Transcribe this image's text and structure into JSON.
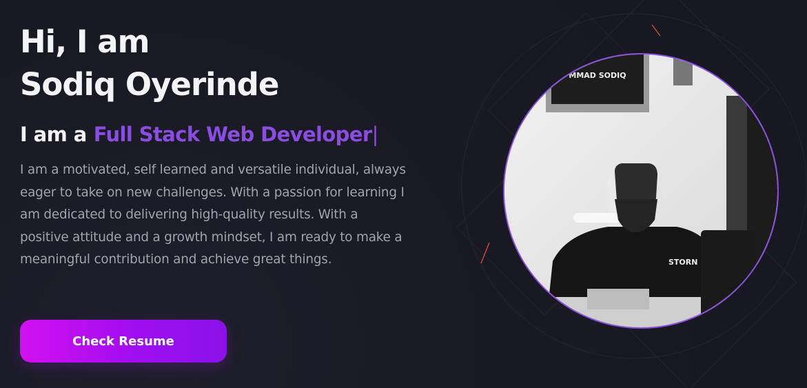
{
  "hero": {
    "greeting": "Hi, I am",
    "name": "Sodiq Oyerinde",
    "role_prefix": "I am a",
    "role_title": "Full Stack Web Developer",
    "role_cursor": "|",
    "bio": "I am a motivated, self learned and versatile individual, always eager to take on new challenges. With a passion for learning I am dedicated to delivering high-quality results. With a positive attitude and a growth mindset, I am ready to make a meaningful contribution and achieve great things.",
    "cta_label": "Check Resume"
  },
  "portrait": {
    "frame_caption": "MMAD SODIQ",
    "shirt_text": "STORN"
  },
  "colors": {
    "background": "#191923",
    "heading": "#f4f4f6",
    "accent": "#8a4de0",
    "body_text": "#a3a3ad",
    "button_start": "#d210f0",
    "button_end": "#8a12e8"
  }
}
